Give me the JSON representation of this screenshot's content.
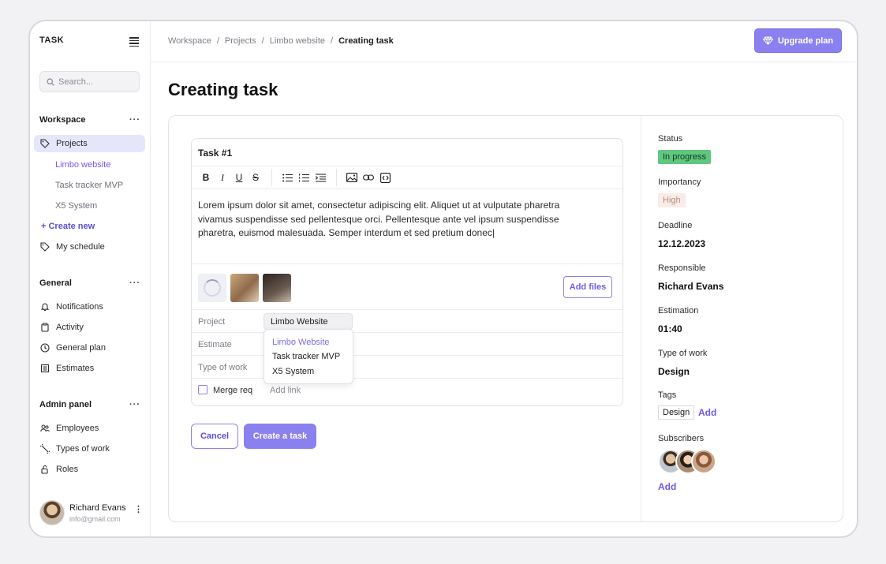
{
  "app": {
    "logo": "TASK"
  },
  "search": {
    "placeholder": "Search..."
  },
  "sidebar": {
    "workspace_title": "Workspace",
    "projects_label": "Projects",
    "project_items": [
      "Limbo website",
      "Task tracker MVP",
      "X5 System"
    ],
    "create_new": "Create new",
    "schedule_label": "My schedule",
    "general_title": "General",
    "general_items": [
      "Notifications",
      "Activity",
      "General plan",
      "Estimates"
    ],
    "admin_title": "Admin panel",
    "admin_items": [
      "Employees",
      "Types of work",
      "Roles"
    ],
    "menu_dots": "···"
  },
  "user": {
    "name": "Richard Evans",
    "email": "info@gmail.com",
    "menu": "⋮"
  },
  "breadcrumbs": {
    "items": [
      "Workspace",
      "Projects",
      "Limbo website"
    ],
    "current": "Creating task",
    "separator": "/"
  },
  "header": {
    "upgrade_label": "Upgrade plan"
  },
  "page": {
    "title": "Creating task"
  },
  "editor": {
    "task_title": "Task #1",
    "body": "Lorem ipsum dolor sit amet, consectetur adipiscing elit. Aliquet ut at vulputate pharetra vivamus suspendisse sed pellentesque orci. Pellentesque ante vel ipsum suspendisse pharetra, euismod malesuada. Semper interdum et sed pretium donec|",
    "add_files": "Add files"
  },
  "fields": {
    "project_label": "Project",
    "project_value": "Limbo Website",
    "estimate_label": "Estimate",
    "type_label": "Type of work",
    "merge_label": "Merge req",
    "add_link": "Add link",
    "dropdown": [
      "Limbo Website",
      "Task tracker MVP",
      "X5 System"
    ]
  },
  "actions": {
    "cancel": "Cancel",
    "create": "Create a task"
  },
  "details": {
    "status_label": "Status",
    "status_value": "In progress",
    "importancy_label": "Importancy",
    "importancy_value": "High",
    "deadline_label": "Deadline",
    "deadline_value": "12.12.2023",
    "responsible_label": "Responsible",
    "responsible_value": "Richard Evans",
    "estimation_label": "Estimation",
    "estimation_value": "01:40",
    "type_label": "Type of work",
    "type_value": "Design",
    "tags_label": "Tags",
    "tag": "Design",
    "tags_add": "Add",
    "subscribers_label": "Subscribers",
    "subscribers_add": "Add"
  },
  "colors": {
    "accent": "#8b80ef",
    "accent_text": "#6d5ce8",
    "status_green": "#5fc77e",
    "high_bg": "#f7ece8"
  }
}
